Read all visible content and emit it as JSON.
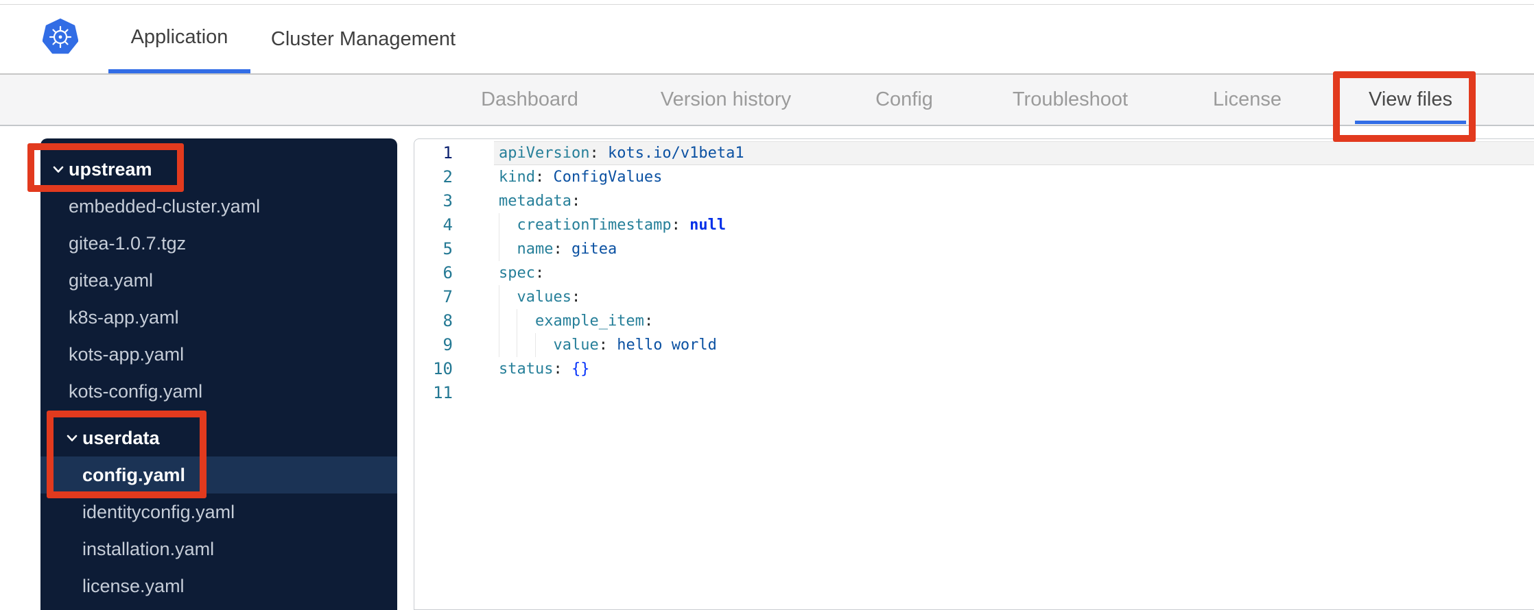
{
  "header": {
    "tabs": [
      {
        "label": "Application",
        "active": true
      },
      {
        "label": "Cluster Management",
        "active": false
      }
    ]
  },
  "nav": {
    "tabs": [
      {
        "label": "Dashboard",
        "active": false
      },
      {
        "label": "Version history",
        "active": false
      },
      {
        "label": "Config",
        "active": false
      },
      {
        "label": "Troubleshoot",
        "active": false
      },
      {
        "label": "License",
        "active": false
      },
      {
        "label": "View files",
        "active": true
      }
    ]
  },
  "file_tree": {
    "items": [
      {
        "label": "upstream",
        "type": "folder",
        "indent": 0,
        "expanded": true
      },
      {
        "label": "embedded-cluster.yaml",
        "type": "file",
        "indent": 0
      },
      {
        "label": "gitea-1.0.7.tgz",
        "type": "file",
        "indent": 0
      },
      {
        "label": "gitea.yaml",
        "type": "file",
        "indent": 0
      },
      {
        "label": "k8s-app.yaml",
        "type": "file",
        "indent": 0
      },
      {
        "label": "kots-app.yaml",
        "type": "file",
        "indent": 0
      },
      {
        "label": "kots-config.yaml",
        "type": "file",
        "indent": 0
      },
      {
        "label": "userdata",
        "type": "folder",
        "indent": 1,
        "expanded": true
      },
      {
        "label": "config.yaml",
        "type": "file",
        "indent": 1,
        "selected": true
      },
      {
        "label": "identityconfig.yaml",
        "type": "file",
        "indent": 1
      },
      {
        "label": "installation.yaml",
        "type": "file",
        "indent": 1
      },
      {
        "label": "license.yaml",
        "type": "file",
        "indent": 1
      }
    ]
  },
  "editor": {
    "lines": [
      {
        "number": 1,
        "active": true,
        "tokens": [
          {
            "t": "key",
            "v": "apiVersion"
          },
          {
            "t": "punc",
            "v": ": "
          },
          {
            "t": "val",
            "v": "kots.io/v1beta1"
          }
        ]
      },
      {
        "number": 2,
        "tokens": [
          {
            "t": "key",
            "v": "kind"
          },
          {
            "t": "punc",
            "v": ": "
          },
          {
            "t": "val",
            "v": "ConfigValues"
          }
        ]
      },
      {
        "number": 3,
        "tokens": [
          {
            "t": "key",
            "v": "metadata"
          },
          {
            "t": "punc",
            "v": ":"
          }
        ]
      },
      {
        "number": 4,
        "tokens": [
          {
            "t": "ws",
            "v": "  "
          },
          {
            "t": "key",
            "v": "creationTimestamp"
          },
          {
            "t": "punc",
            "v": ": "
          },
          {
            "t": "kw",
            "v": "null"
          }
        ]
      },
      {
        "number": 5,
        "tokens": [
          {
            "t": "ws",
            "v": "  "
          },
          {
            "t": "key",
            "v": "name"
          },
          {
            "t": "punc",
            "v": ": "
          },
          {
            "t": "val",
            "v": "gitea"
          }
        ]
      },
      {
        "number": 6,
        "tokens": [
          {
            "t": "key",
            "v": "spec"
          },
          {
            "t": "punc",
            "v": ":"
          }
        ]
      },
      {
        "number": 7,
        "tokens": [
          {
            "t": "ws",
            "v": "  "
          },
          {
            "t": "key",
            "v": "values"
          },
          {
            "t": "punc",
            "v": ":"
          }
        ]
      },
      {
        "number": 8,
        "tokens": [
          {
            "t": "ws",
            "v": "    "
          },
          {
            "t": "key",
            "v": "example_item"
          },
          {
            "t": "punc",
            "v": ":"
          }
        ]
      },
      {
        "number": 9,
        "tokens": [
          {
            "t": "ws",
            "v": "      "
          },
          {
            "t": "key",
            "v": "value"
          },
          {
            "t": "punc",
            "v": ": "
          },
          {
            "t": "val",
            "v": "hello world"
          }
        ]
      },
      {
        "number": 10,
        "tokens": [
          {
            "t": "key",
            "v": "status"
          },
          {
            "t": "punc",
            "v": ": "
          },
          {
            "t": "bracket",
            "v": "{}"
          }
        ]
      },
      {
        "number": 11,
        "tokens": []
      }
    ]
  },
  "annotations": {
    "color": "#e23a1e",
    "boxes": [
      {
        "name": "view-files-tab-highlight"
      },
      {
        "name": "upstream-folder-highlight"
      },
      {
        "name": "userdata-config-highlight"
      }
    ]
  },
  "colors": {
    "accent_blue": "#326de6",
    "nav_bg": "#f5f5f6",
    "sidebar_bg": "#0d1c36",
    "sidebar_selected_bg": "#1b3355",
    "yaml_key": "#267f99",
    "yaml_value": "#0b51a2",
    "yaml_keyword": "#0330e8",
    "gutter_number": "#237893",
    "gutter_active": "#0b216f",
    "annotation_red": "#e23a1e"
  }
}
